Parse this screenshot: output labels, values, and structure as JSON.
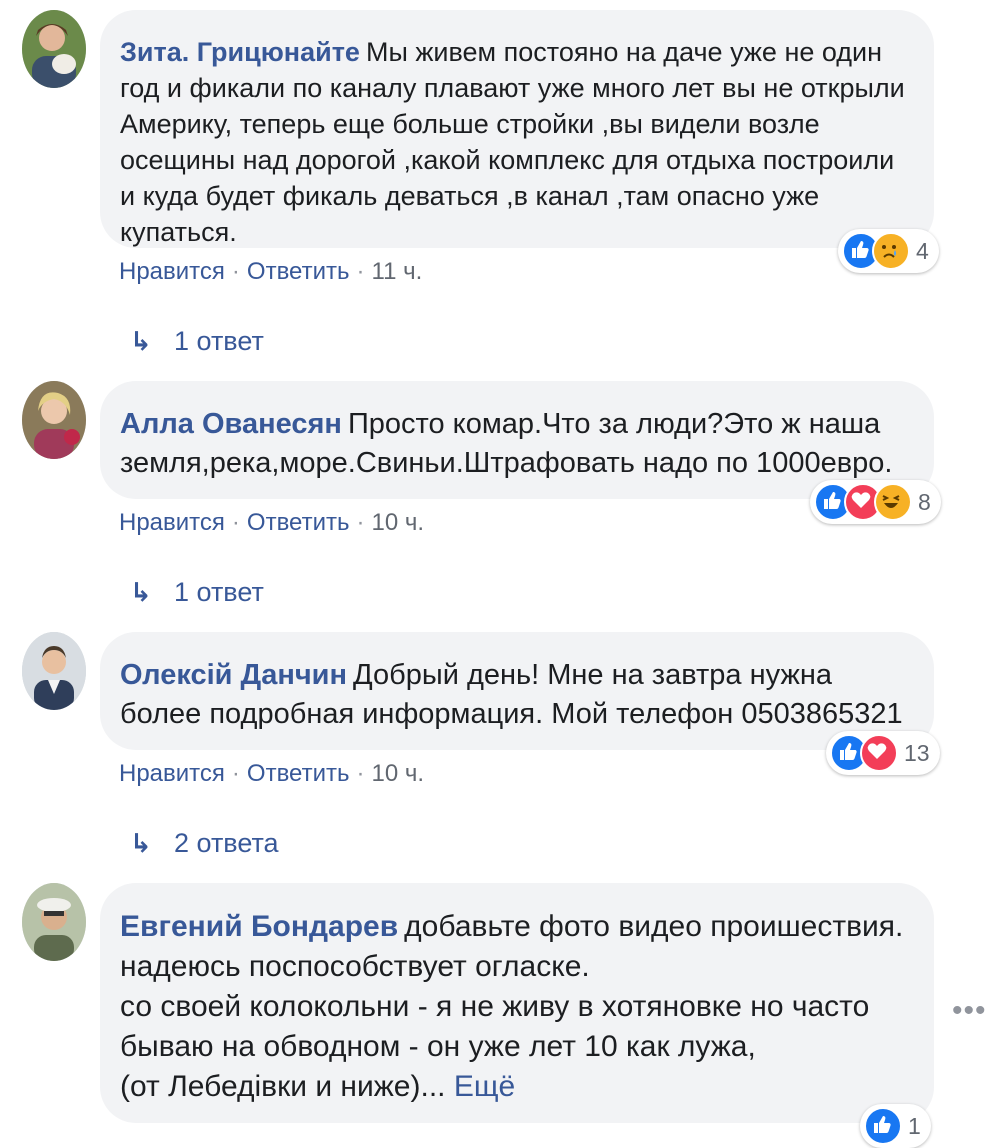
{
  "comments": [
    {
      "author": "Зита. Грицюнайте",
      "text": "Мы живем постояно на даче уже не один год и фикали по каналу плавают уже много лет вы не открыли Америку, теперь еще больше стройки ,вы видели возле осещины над дорогой ,какой комплекс для отдыха построили и куда будет фикаль деваться ,в канал ,там опасно уже купаться.",
      "like_label": "Нравится",
      "reply_label": "Ответить",
      "time": "11 ч.",
      "reactions": [
        "like-icon",
        "sad-icon"
      ],
      "reaction_count": "4",
      "replies_label": "1 ответ"
    },
    {
      "author": "Алла Ованесян",
      "text": "Просто комар.Что за люди?Это ж наша земля,река,море.Свиньи.Штрафовать надо по 1000евро.",
      "like_label": "Нравится",
      "reply_label": "Ответить",
      "time": "10 ч.",
      "reactions": [
        "like-icon",
        "love-icon",
        "haha-icon"
      ],
      "reaction_count": "8",
      "replies_label": "1 ответ"
    },
    {
      "author": "Олексій Данчин",
      "text": "Добрый день! Мне на завтра нужна более подробная информация. Мой телефон 0503865321",
      "like_label": "Нравится",
      "reply_label": "Ответить",
      "time": "10 ч.",
      "reactions": [
        "like-icon",
        "love-icon"
      ],
      "reaction_count": "13",
      "replies_label": "2 ответа"
    },
    {
      "author": "Евгений Бондарев",
      "lines": [
        "добавьте фото видео проишествия.",
        "надеюсь поспособствует огласке.",
        "со своей колокольни - я не живу в хотяновке но часто бываю на обводном - он уже лет 10 как лужа,",
        "(от Лебедівки и ниже)..."
      ],
      "see_more": "Ещё",
      "reaction_count": "1"
    }
  ],
  "colors": {
    "link": "#385898",
    "bubble": "#f2f3f5",
    "meta": "#616770",
    "like": "#1877f2",
    "love": "#f33e58",
    "emoji": "#f7b125"
  }
}
